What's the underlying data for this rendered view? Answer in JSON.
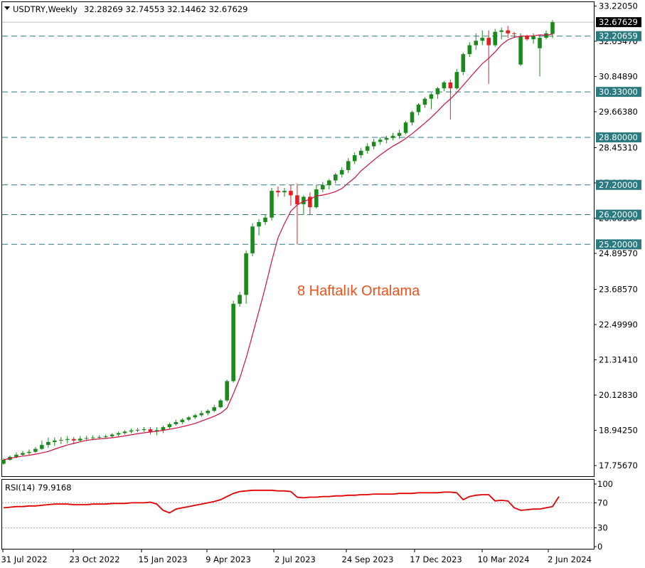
{
  "header": {
    "symbol": "USDTRY,Weekly",
    "ohlc": "32.28269 32.74553 32.14462 32.67629"
  },
  "annotation": {
    "text": "8 Haftalık Ortalama"
  },
  "colors": {
    "up": "#1a8a1a",
    "down": "#e81c1c",
    "ma": "#d01040",
    "level": "#2a7a80",
    "rsi": "#e00000",
    "annotation": "#f0501a"
  },
  "chart_data": [
    {
      "type": "candlestick",
      "y_ticks": [
        "33.22050",
        "32.03470",
        "30.84890",
        "29.66380",
        "28.45310",
        "27.26730",
        "26.08150",
        "24.89570",
        "23.68570",
        "22.49990",
        "21.31410",
        "20.12830",
        "18.94250",
        "17.75670"
      ],
      "x_ticks": [
        "31 Jul 2022",
        "23 Oct 2022",
        "15 Jan 2023",
        "9 Apr 2023",
        "2 Jul 2023",
        "24 Sep 2023",
        "17 Dec 2023",
        "10 Mar 2024",
        "2 Jun 2024"
      ],
      "ylim": [
        17.4,
        33.35
      ],
      "current_price": "32.67629",
      "levels": [
        {
          "value": 32.20659,
          "label": "32.20659"
        },
        {
          "value": 30.33,
          "label": "30.33000"
        },
        {
          "value": 28.8,
          "label": "28.80000"
        },
        {
          "value": 27.2,
          "label": "27.20000"
        },
        {
          "value": 26.2,
          "label": "26.20000"
        },
        {
          "value": 25.2,
          "label": "25.20000"
        }
      ],
      "ma_period": 8,
      "candles": [
        [
          17.82,
          18.0,
          17.78,
          17.95
        ],
        [
          17.95,
          18.1,
          17.92,
          18.05
        ],
        [
          18.05,
          18.2,
          18.0,
          18.12
        ],
        [
          18.12,
          18.25,
          18.08,
          18.18
        ],
        [
          18.18,
          18.3,
          18.12,
          18.22
        ],
        [
          18.22,
          18.38,
          18.18,
          18.32
        ],
        [
          18.32,
          18.6,
          18.28,
          18.45
        ],
        [
          18.45,
          18.7,
          18.35,
          18.55
        ],
        [
          18.55,
          18.7,
          18.42,
          18.6
        ],
        [
          18.6,
          18.72,
          18.48,
          18.62
        ],
        [
          18.62,
          18.75,
          18.5,
          18.65
        ],
        [
          18.65,
          18.72,
          18.48,
          18.6
        ],
        [
          18.6,
          18.75,
          18.55,
          18.66
        ],
        [
          18.66,
          18.76,
          18.6,
          18.68
        ],
        [
          18.68,
          18.78,
          18.62,
          18.7
        ],
        [
          18.7,
          18.78,
          18.64,
          18.72
        ],
        [
          18.72,
          18.8,
          18.66,
          18.74
        ],
        [
          18.74,
          18.85,
          18.7,
          18.8
        ],
        [
          18.8,
          18.9,
          18.74,
          18.85
        ],
        [
          18.85,
          18.95,
          18.8,
          18.9
        ],
        [
          18.9,
          19.0,
          18.84,
          18.94
        ],
        [
          18.94,
          19.02,
          18.88,
          18.96
        ],
        [
          18.96,
          19.05,
          18.9,
          18.98
        ],
        [
          18.98,
          19.05,
          18.8,
          18.9
        ],
        [
          18.9,
          19.05,
          18.78,
          18.95
        ],
        [
          18.95,
          19.1,
          18.85,
          19.05
        ],
        [
          19.05,
          19.2,
          19.0,
          19.15
        ],
        [
          19.15,
          19.3,
          19.1,
          19.22
        ],
        [
          19.22,
          19.35,
          19.15,
          19.3
        ],
        [
          19.3,
          19.42,
          19.25,
          19.38
        ],
        [
          19.38,
          19.5,
          19.32,
          19.45
        ],
        [
          19.45,
          19.6,
          19.4,
          19.52
        ],
        [
          19.52,
          19.65,
          19.45,
          19.6
        ],
        [
          19.6,
          19.8,
          19.55,
          19.72
        ],
        [
          19.72,
          20.0,
          19.68,
          19.95
        ],
        [
          19.95,
          20.65,
          19.9,
          20.6
        ],
        [
          20.6,
          23.3,
          20.55,
          23.2
        ],
        [
          23.2,
          23.6,
          23.1,
          23.5
        ],
        [
          23.5,
          25.0,
          23.2,
          24.9
        ],
        [
          24.9,
          25.9,
          24.8,
          25.8
        ],
        [
          25.8,
          26.05,
          25.5,
          25.95
        ],
        [
          25.95,
          26.2,
          25.85,
          26.1
        ],
        [
          26.1,
          27.1,
          26.0,
          27.0
        ],
        [
          27.0,
          27.15,
          26.8,
          26.95
        ],
        [
          26.95,
          27.1,
          26.8,
          27.0
        ],
        [
          27.0,
          27.2,
          26.5,
          26.85
        ],
        [
          26.85,
          27.25,
          25.2,
          26.55
        ],
        [
          26.55,
          26.85,
          26.2,
          26.8
        ],
        [
          26.8,
          26.95,
          26.2,
          26.45
        ],
        [
          26.45,
          27.2,
          26.4,
          27.05
        ],
        [
          27.05,
          27.3,
          26.95,
          27.2
        ],
        [
          27.2,
          27.4,
          27.05,
          27.35
        ],
        [
          27.35,
          27.6,
          27.25,
          27.55
        ],
        [
          27.55,
          27.8,
          27.45,
          27.7
        ],
        [
          27.7,
          28.1,
          27.6,
          28.0
        ],
        [
          28.0,
          28.3,
          27.9,
          28.2
        ],
        [
          28.2,
          28.45,
          28.1,
          28.35
        ],
        [
          28.35,
          28.6,
          28.25,
          28.5
        ],
        [
          28.5,
          28.75,
          28.4,
          28.65
        ],
        [
          28.65,
          28.8,
          28.55,
          28.72
        ],
        [
          28.72,
          28.85,
          28.6,
          28.78
        ],
        [
          28.78,
          28.95,
          28.7,
          28.85
        ],
        [
          28.85,
          29.05,
          28.75,
          28.95
        ],
        [
          28.95,
          29.35,
          28.9,
          29.3
        ],
        [
          29.3,
          29.7,
          29.2,
          29.65
        ],
        [
          29.65,
          29.95,
          29.55,
          29.9
        ],
        [
          29.9,
          30.15,
          29.8,
          30.1
        ],
        [
          30.1,
          30.3,
          29.75,
          30.25
        ],
        [
          30.25,
          30.5,
          30.1,
          30.45
        ],
        [
          30.45,
          30.7,
          30.35,
          30.65
        ],
        [
          30.65,
          30.75,
          29.4,
          30.45
        ],
        [
          30.45,
          31.1,
          30.4,
          31.0
        ],
        [
          31.0,
          31.65,
          30.9,
          31.6
        ],
        [
          31.6,
          32.0,
          31.5,
          31.9
        ],
        [
          31.9,
          32.3,
          31.75,
          32.05
        ],
        [
          32.05,
          32.4,
          31.9,
          32.15
        ],
        [
          32.15,
          32.4,
          30.6,
          31.9
        ],
        [
          31.9,
          32.45,
          31.85,
          32.35
        ],
        [
          32.35,
          32.5,
          32.1,
          32.4
        ],
        [
          32.4,
          32.55,
          32.15,
          32.3
        ],
        [
          32.3,
          32.35,
          32.15,
          32.28
        ],
        [
          31.25,
          32.3,
          31.2,
          32.2
        ],
        [
          32.2,
          32.25,
          32.05,
          32.1
        ],
        [
          32.1,
          32.3,
          31.95,
          32.2
        ],
        [
          31.8,
          32.25,
          30.85,
          32.15
        ],
        [
          32.15,
          32.4,
          32.1,
          32.3
        ],
        [
          32.28269,
          32.74553,
          32.14462,
          32.67629
        ]
      ]
    },
    {
      "type": "line",
      "title": "RSI(14) 79.9168",
      "y_ticks": [
        "100",
        "70",
        "30",
        "0"
      ],
      "ylim": [
        0,
        100
      ],
      "ref_levels": [
        70,
        30
      ],
      "values": [
        62,
        63,
        64,
        64,
        65,
        65,
        66,
        67,
        68,
        68,
        68,
        67,
        67,
        67,
        68,
        68,
        68,
        69,
        69,
        69,
        70,
        70,
        70,
        71,
        68,
        58,
        54,
        60,
        62,
        64,
        66,
        68,
        70,
        72,
        75,
        80,
        85,
        88,
        89,
        90,
        90,
        90,
        90,
        89,
        89,
        88,
        79,
        78,
        79,
        79,
        80,
        80,
        81,
        81,
        82,
        82,
        83,
        83,
        84,
        84,
        84,
        84,
        85,
        85,
        85,
        86,
        86,
        86,
        86,
        87,
        87,
        86,
        75,
        80,
        82,
        83,
        83,
        73,
        74,
        73,
        62,
        58,
        59,
        60,
        60,
        62,
        64,
        80
      ]
    }
  ]
}
